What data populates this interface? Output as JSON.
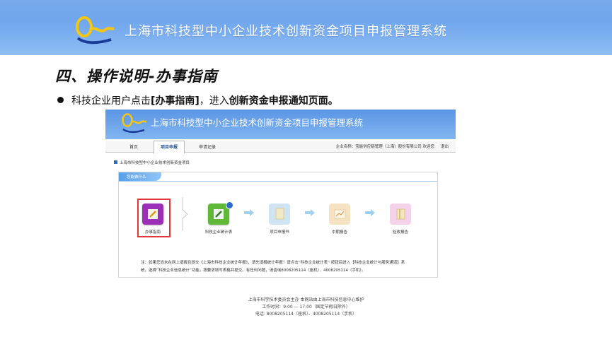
{
  "banner": {
    "title": "上海市科技型中小企业技术创新资金项目申报管理系统"
  },
  "slide": {
    "heading": "四、操作说明-办事指南",
    "bullet_pre": "科技企业用户点击",
    "bullet_link": "[办事指南]",
    "bullet_mid": "，进入",
    "bullet_target": "创新资金申报通知页面。"
  },
  "screenshot": {
    "title": "上海市科技型中小企业技术创新资金项目申报管理系统",
    "nav": [
      {
        "label": "首页"
      },
      {
        "label": "项目申报"
      },
      {
        "label": "申请记录"
      }
    ],
    "company": "企业名称：宝能供应链管理（上海）股份有限公司  欢迎您",
    "logout": "退出",
    "breadcrumb": "上海市科技型中小企业技术创新资金项目",
    "panel_tab": "您能做什么",
    "steps": [
      {
        "label": "办事指南",
        "color": "#9b2fb5",
        "icon": "pencil-icon"
      },
      {
        "label": "科技企业统计表",
        "color": "#5fb837",
        "icon": "pencil-icon"
      },
      {
        "label": "项目申报书",
        "color": "#cfe3f1",
        "icon": "document-icon"
      },
      {
        "label": "中期报告",
        "color": "#f5e2c2",
        "icon": "chart-icon"
      },
      {
        "label": "验收报告",
        "color": "#f4d3ea",
        "icon": "book-icon"
      }
    ],
    "note_line1": "注：如果您尚未在网上填报且提交《上海市科技企业统计年报》，请先填报统计年报！请点击“科技企业统计表” 按钮后进入【科技企业统计与服务通道】系",
    "note_line2": "统，选择“科技企业信息统计”功能，按要求填写表格并提交。有任何问题，请咨询8008205114（座机）、4008205114（手机）。",
    "footer": [
      "上海市科学技术委员会主办 本网站由上海市科技信息中心维护",
      "工作时间：9:00 — 17:00（国定节假日除外）",
      "电话: 8008205114（座机）、4008205114（手机）"
    ]
  }
}
